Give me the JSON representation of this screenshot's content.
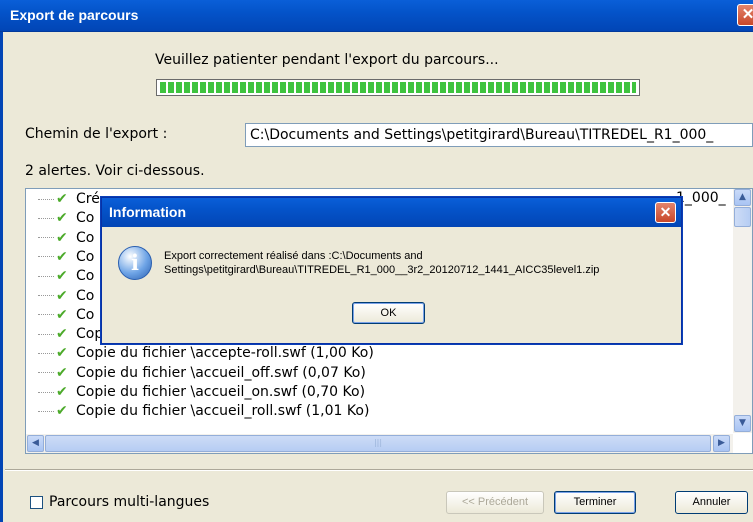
{
  "window": {
    "title": "Export de parcours",
    "close_glyph": "✕"
  },
  "progress": {
    "message": "Veuillez patienter pendant l'export du parcours...",
    "fraction": 1.0
  },
  "export_path": {
    "label": "Chemin de l'export :",
    "value": "C:\\Documents and Settings\\petitgirard\\Bureau\\TITREDEL_R1_000_"
  },
  "alerts_text": "2 alertes. Voir ci-dessous.",
  "log_items": [
    "Cré",
    "Co",
    "Co",
    "Co",
    "Co",
    "Co",
    "Co",
    "Copie du fichier \\accepte-on.swf (1,01 Ko)",
    "Copie du fichier \\accepte-roll.swf (1,00 Ko)",
    "Copie du fichier \\accueil_off.swf (0,07 Ko)",
    "Copie du fichier \\accueil_on.swf (0,70 Ko)",
    "Copie du fichier \\accueil_roll.swf (1,01 Ko)"
  ],
  "log_first_row_tail": "1_000_",
  "footer": {
    "checkbox_label": "Parcours multi-langues",
    "prev_button": "<< Précédent",
    "finish_button": "Terminer",
    "cancel_button": "Annuler"
  },
  "dialog": {
    "title": "Information",
    "icon": "info-icon",
    "message_line1": "Export correctement réalisé dans :C:\\Documents and",
    "message_line2": "Settings\\petitgirard\\Bureau\\TITREDEL_R1_000__3r2_20120712_1441_AICC35level1.zip",
    "ok_button": "OK"
  },
  "colors": {
    "titlebar": "#0453c9",
    "progress": "#3fc33f",
    "check": "#4caa2a"
  }
}
